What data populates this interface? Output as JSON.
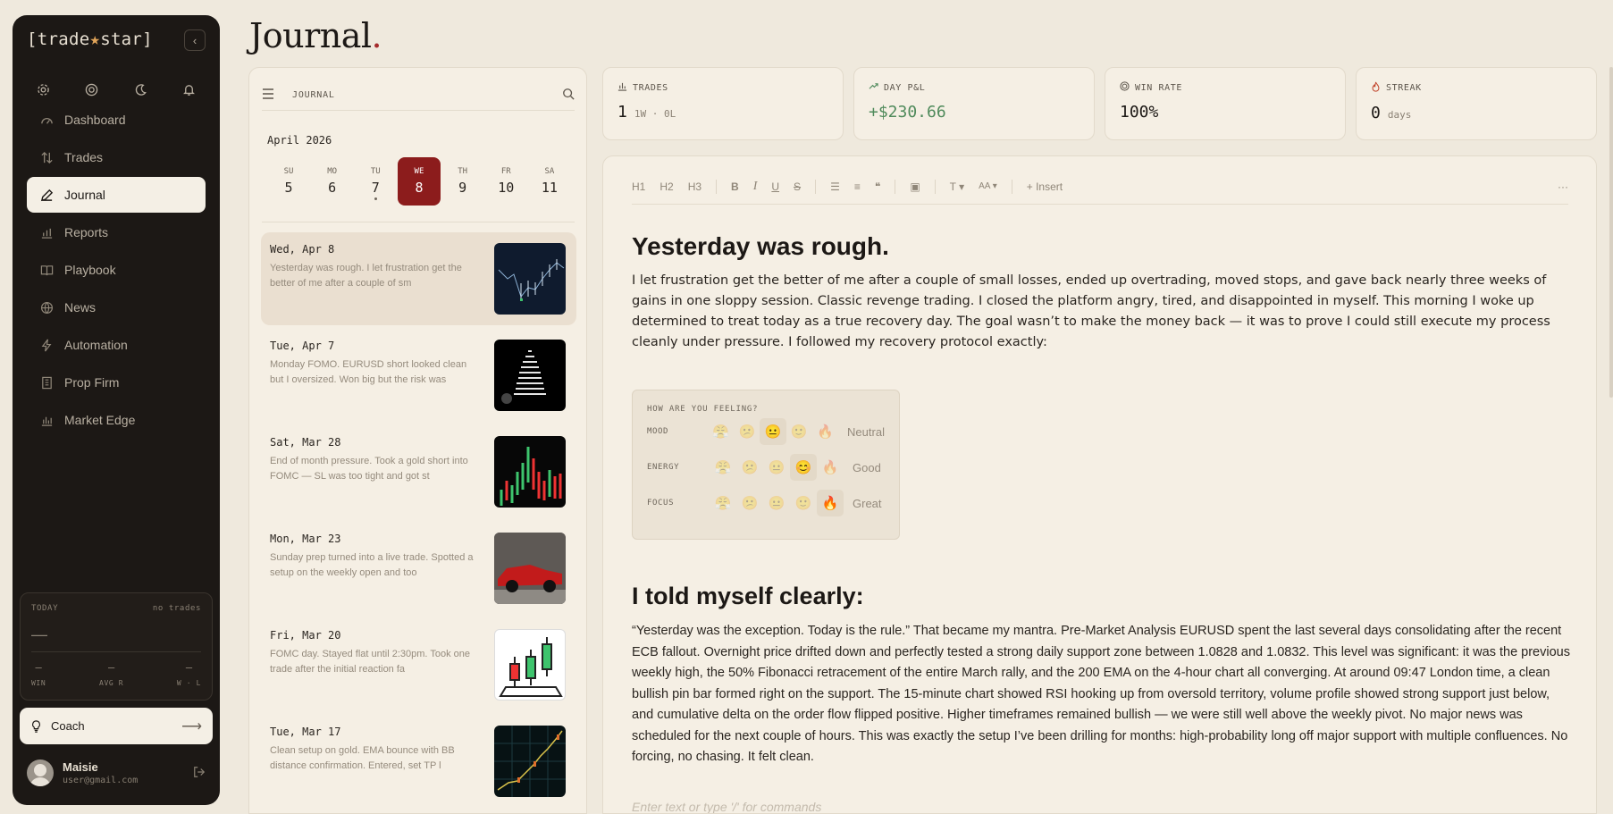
{
  "sidebar": {
    "logo": {
      "bracket_l": "[",
      "part1": "trade",
      "star": "★",
      "part2": "star",
      "bracket_r": "]"
    },
    "collapse_icon": "‹",
    "top_icons": [
      "gear-icon",
      "help-icon",
      "moon-icon",
      "bell-icon"
    ],
    "nav": [
      {
        "label": "Dashboard",
        "icon": "gauge-icon",
        "active": false
      },
      {
        "label": "Trades",
        "icon": "arrows-icon",
        "active": false
      },
      {
        "label": "Journal",
        "icon": "pencil-icon",
        "active": true
      },
      {
        "label": "Reports",
        "icon": "chart-icon",
        "active": false
      },
      {
        "label": "Playbook",
        "icon": "book-icon",
        "active": false
      },
      {
        "label": "News",
        "icon": "globe-icon",
        "active": false
      },
      {
        "label": "Automation",
        "icon": "bolt-icon",
        "active": false
      },
      {
        "label": "Prop Firm",
        "icon": "building-icon",
        "active": false
      },
      {
        "label": "Market Edge",
        "icon": "trend-icon",
        "active": false
      }
    ],
    "today": {
      "label": "TODAY",
      "status": "no trades",
      "value": "—",
      "stats": [
        {
          "value": "–",
          "label": "WIN"
        },
        {
          "value": "–",
          "label": "AVG R"
        },
        {
          "value": "–",
          "label": "W · L"
        }
      ]
    },
    "coach": {
      "label": "Coach",
      "arrow": "⟶"
    },
    "user": {
      "name": "Maisie",
      "email": "user@gmail.com"
    }
  },
  "page": {
    "title": "Journal",
    "title_dot": "."
  },
  "journal_panel": {
    "label": "JOURNAL",
    "month": "April 2026",
    "days": [
      {
        "dow": "SU",
        "num": "5",
        "active": false,
        "dot": false
      },
      {
        "dow": "MO",
        "num": "6",
        "active": false,
        "dot": false
      },
      {
        "dow": "TU",
        "num": "7",
        "active": false,
        "dot": true
      },
      {
        "dow": "WE",
        "num": "8",
        "active": true,
        "dot": false
      },
      {
        "dow": "TH",
        "num": "9",
        "active": false,
        "dot": false
      },
      {
        "dow": "FR",
        "num": "10",
        "active": false,
        "dot": false
      },
      {
        "dow": "SA",
        "num": "11",
        "active": false,
        "dot": false
      }
    ],
    "entries": [
      {
        "date": "Wed, Apr 8",
        "snippet": "Yesterday was rough. I let frustration get the better of me after a couple of sm",
        "active": true
      },
      {
        "date": "Tue, Apr 7",
        "snippet": "Monday FOMO. EURUSD short looked clean but I oversized. Won big but the risk was",
        "active": false
      },
      {
        "date": "Sat, Mar 28",
        "snippet": "End of month pressure. Took a gold short into FOMC — SL was too tight and got st",
        "active": false
      },
      {
        "date": "Mon, Mar 23",
        "snippet": "Sunday prep turned into a live trade. Spotted a setup on the weekly open and too",
        "active": false
      },
      {
        "date": "Fri, Mar 20",
        "snippet": "FOMC day. Stayed flat until 2:30pm. Took one trade after the initial reaction fa",
        "active": false
      },
      {
        "date": "Tue, Mar 17",
        "snippet": "Clean setup on gold. EMA bounce with BB distance confirmation. Entered, set TP l",
        "active": false
      }
    ]
  },
  "stats": [
    {
      "label": "TRADES",
      "icon": "bar-chart-icon",
      "value": "1",
      "sub": "1W · 0L"
    },
    {
      "label": "DAY P&L",
      "icon": "trend-up-icon",
      "value": "+$230.66",
      "sub": ""
    },
    {
      "label": "WIN RATE",
      "icon": "target-icon",
      "value": "100%",
      "sub": ""
    },
    {
      "label": "STREAK",
      "icon": "flame-icon",
      "value": "0",
      "sub": "days"
    }
  ],
  "toolbar": {
    "h1": "H1",
    "h2": "H2",
    "h3": "H3",
    "bold": "B",
    "italic": "I",
    "underline": "U",
    "strike": "S",
    "bullets": "☰",
    "numbered": "≡",
    "quote": "❝",
    "image": "▣",
    "text_style": "T ▾",
    "font_size": "AA ▾",
    "insert": "+ Insert",
    "more": "···"
  },
  "editor": {
    "heading1": "Yesterday was rough.",
    "para1": "I let frustration get the better of me after a couple of small losses, ended up overtrading, moved stops, and gave back nearly three weeks of gains in one sloppy session. Classic revenge trading. I closed the platform angry, tired, and disappointed in myself. This morning I woke up determined to treat today as a true recovery day. The goal wasn’t to make the money back — it was to prove I could still execute my process cleanly under pressure. I followed my recovery protocol exactly:",
    "feelings": {
      "title": "HOW ARE YOU FEELING?",
      "rows": [
        {
          "label": "MOOD",
          "word": "Neutral",
          "emojis": [
            "😤",
            "😕",
            "😐",
            "🙂",
            "🔥"
          ],
          "selected": 2
        },
        {
          "label": "ENERGY",
          "word": "Good",
          "emojis": [
            "😤",
            "😕",
            "😐",
            "😊",
            "🔥"
          ],
          "selected": 3
        },
        {
          "label": "FOCUS",
          "word": "Great",
          "emojis": [
            "😤",
            "😕",
            "😐",
            "🙂",
            "🔥"
          ],
          "selected": 4
        }
      ]
    },
    "heading2": "I told myself clearly:",
    "para2": " “Yesterday was the exception. Today is the rule.” That became my mantra. Pre-Market Analysis EURUSD spent the last several days consolidating after the recent ECB fallout. Overnight price drifted down and perfectly tested a strong daily support zone between 1.0828 and 1.0832. This level was significant: it was the previous weekly high, the 50% Fibonacci retracement of the entire March rally, and the 200 EMA on the 4-hour chart all converging. At around 09:47 London time, a clean bullish pin bar formed right on the support. The 15-minute chart showed RSI hooking up from oversold territory, volume profile showed strong support just below, and cumulative delta on the order flow flipped positive. Higher timeframes remained bullish — we were still well above the weekly pivot. No major news was scheduled for the next couple of hours. This was exactly the setup I’ve been drilling for months: high-probability long off major support with multiple confluences. No forcing, no chasing. It felt clean.",
    "placeholder": "Enter text or type '/' for commands"
  }
}
